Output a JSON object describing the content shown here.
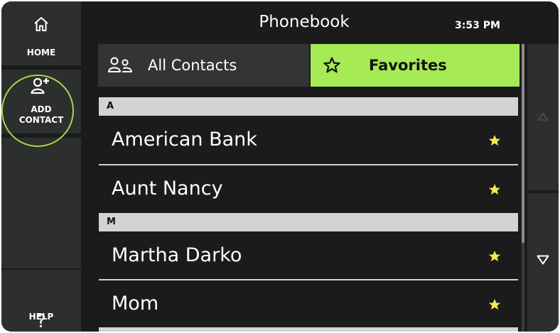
{
  "sidebar": {
    "home_label": "HOME",
    "add_contact_label_1": "ADD",
    "add_contact_label_2": "CONTACT",
    "help_glyph": "?",
    "help_label": "HELP"
  },
  "header": {
    "title": "Phonebook",
    "time": "3:53 PM"
  },
  "tabs": [
    {
      "label": "All Contacts",
      "icon": "contacts-icon",
      "selected": false
    },
    {
      "label": "Favorites",
      "icon": "star-outline-icon",
      "selected": true
    }
  ],
  "contacts": {
    "sections": [
      {
        "letter": "A",
        "items": [
          {
            "name": "American Bank",
            "favorite": true
          },
          {
            "name": "Aunt Nancy",
            "favorite": true
          }
        ]
      },
      {
        "letter": "M",
        "items": [
          {
            "name": "Martha Darko",
            "favorite": true
          },
          {
            "name": "Mom",
            "favorite": true
          }
        ]
      }
    ]
  },
  "colors": {
    "accent_green": "#a6ea56",
    "highlight_ring": "#a6d648",
    "star_yellow": "#f6e84a",
    "panel": "#2d2e2e",
    "background": "#1b1b1b"
  }
}
